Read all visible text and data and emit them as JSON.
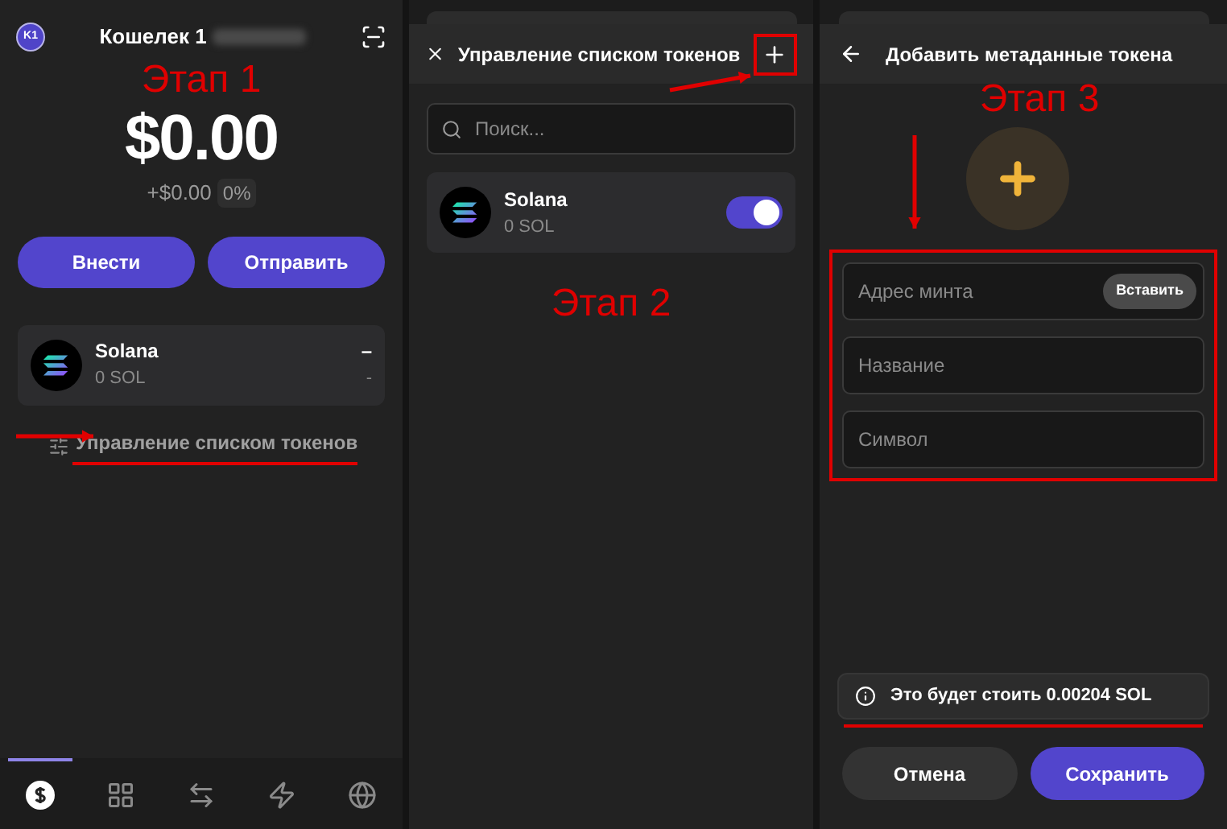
{
  "wallet": {
    "avatar": "K1",
    "title": "Кошелек 1",
    "stage": "Этап 1",
    "balance": "$0.00",
    "change": "+$0.00",
    "change_percent": "0%",
    "buttons": [
      "Внести",
      "Отправить"
    ],
    "tokens": [
      {
        "name": "Solana",
        "amount": "0 SOL",
        "value": "–",
        "change": "-"
      }
    ],
    "manage_link": "Управление списком токенов",
    "nav": [
      {
        "kind": "dollar",
        "selected": true
      },
      {
        "kind": "grid",
        "selected": false
      },
      {
        "kind": "swap",
        "selected": false
      },
      {
        "kind": "bolt",
        "selected": false
      },
      {
        "kind": "globe",
        "selected": false
      }
    ]
  },
  "manage_tokens": {
    "title": "Управление списком токенов",
    "search": {
      "placeholder": "Поиск..."
    },
    "tokens": [
      {
        "name": "Solana",
        "amount": "0 SOL",
        "on": true
      }
    ],
    "stage": "Этап 2"
  },
  "add_metadata": {
    "title": "Добавить метаданные токена",
    "stage": "Этап 3",
    "fields": [
      {
        "placeholder": "Адрес минта",
        "action": "Вставить"
      },
      {
        "placeholder": "Название"
      },
      {
        "placeholder": "Символ"
      }
    ],
    "notice": "Это будет стоить 0.00204 SOL",
    "buttons": [
      {
        "label": "Отмена",
        "kind": "secondary"
      },
      {
        "label": "Сохранить",
        "kind": "primary"
      }
    ]
  }
}
